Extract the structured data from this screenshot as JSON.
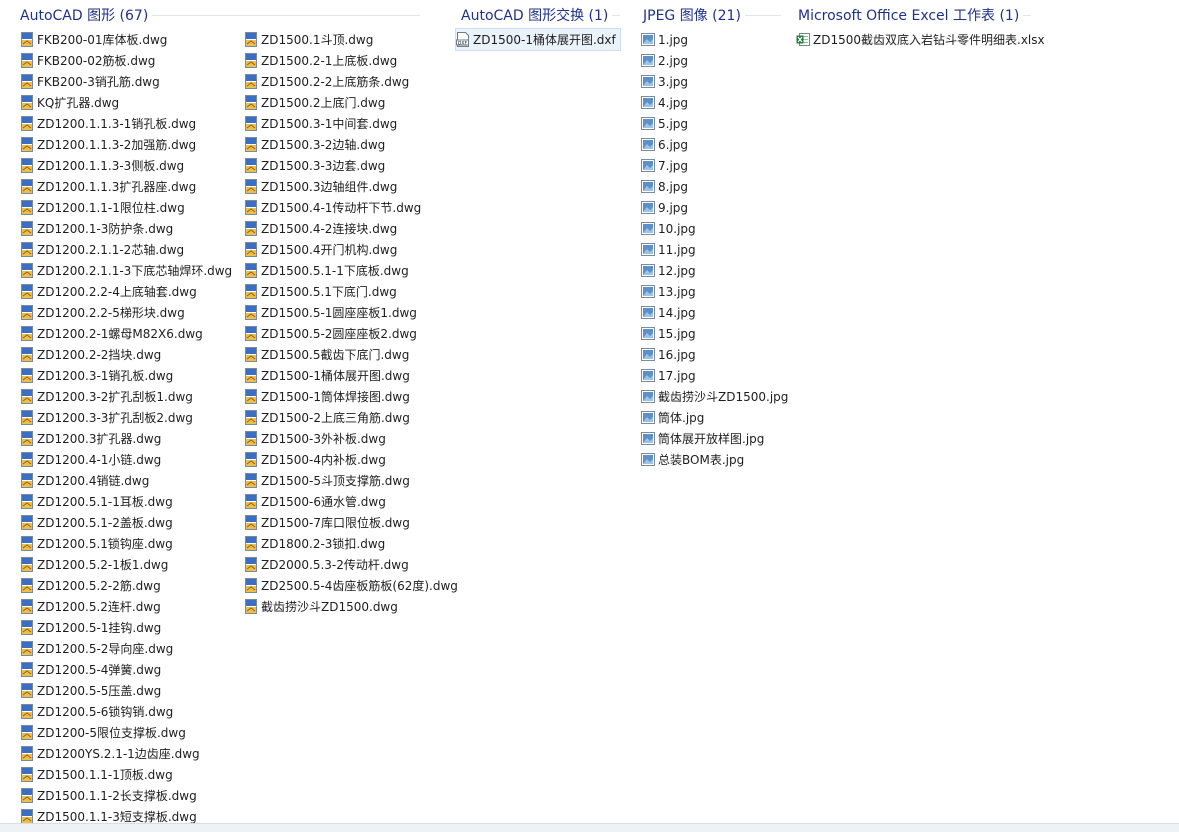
{
  "groups": [
    {
      "key": "dwg",
      "title": "AutoCAD 图形 (67)",
      "icon": "dwg-file-icon",
      "columns": [
        [
          "FKB200-01库体板.dwg",
          "FKB200-02筋板.dwg",
          "FKB200-3销孔筋.dwg",
          "KQ扩孔器.dwg",
          "ZD1200.1.1.3-1销孔板.dwg",
          "ZD1200.1.1.3-2加强筋.dwg",
          "ZD1200.1.1.3-3侧板.dwg",
          "ZD1200.1.1.3扩孔器座.dwg",
          "ZD1200.1.1-1限位柱.dwg",
          "ZD1200.1-3防护条.dwg",
          "ZD1200.2.1.1-2芯轴.dwg",
          "ZD1200.2.1.1-3下底芯轴焊环.dwg",
          "ZD1200.2.2-4上底轴套.dwg",
          "ZD1200.2.2-5梯形块.dwg",
          "ZD1200.2-1螺母M82X6.dwg",
          "ZD1200.2-2挡块.dwg",
          "ZD1200.3-1销孔板.dwg",
          "ZD1200.3-2扩孔刮板1.dwg",
          "ZD1200.3-3扩孔刮板2.dwg",
          "ZD1200.3扩孔器.dwg",
          "ZD1200.4-1小链.dwg",
          "ZD1200.4销链.dwg",
          "ZD1200.5.1-1耳板.dwg",
          "ZD1200.5.1-2盖板.dwg",
          "ZD1200.5.1锁钩座.dwg",
          "ZD1200.5.2-1板1.dwg",
          "ZD1200.5.2-2筋.dwg",
          "ZD1200.5.2连杆.dwg",
          "ZD1200.5-1挂钩.dwg",
          "ZD1200.5-2导向座.dwg",
          "ZD1200.5-4弹簧.dwg",
          "ZD1200.5-5压盖.dwg",
          "ZD1200.5-6锁钩销.dwg",
          "ZD1200-5限位支撑板.dwg",
          "ZD1200YS.2.1-1边齿座.dwg",
          "ZD1500.1.1-1顶板.dwg",
          "ZD1500.1.1-2长支撑板.dwg",
          "ZD1500.1.1-3短支撑板.dwg"
        ],
        [
          "ZD1500.1斗顶.dwg",
          "ZD1500.2-1上底板.dwg",
          "ZD1500.2-2上底筋条.dwg",
          "ZD1500.2上底门.dwg",
          "ZD1500.3-1中间套.dwg",
          "ZD1500.3-2边轴.dwg",
          "ZD1500.3-3边套.dwg",
          "ZD1500.3边轴组件.dwg",
          "ZD1500.4-1传动杆下节.dwg",
          "ZD1500.4-2连接块.dwg",
          "ZD1500.4开门机构.dwg",
          "ZD1500.5.1-1下底板.dwg",
          "ZD1500.5.1下底门.dwg",
          "ZD1500.5-1圆座座板1.dwg",
          "ZD1500.5-2圆座座板2.dwg",
          "ZD1500.5截齿下底门.dwg",
          "ZD1500-1桶体展开图.dwg",
          "ZD1500-1筒体焊接图.dwg",
          "ZD1500-2上底三角筋.dwg",
          "ZD1500-3外补板.dwg",
          "ZD1500-4内补板.dwg",
          "ZD1500-5斗顶支撑筋.dwg",
          "ZD1500-6通水管.dwg",
          "ZD1500-7库口限位板.dwg",
          "ZD1800.2-3锁扣.dwg",
          "ZD2000.5.3-2传动杆.dwg",
          "ZD2500.5-4齿座板筋板(62度).dwg",
          "截齿捞沙斗ZD1500.dwg"
        ]
      ]
    },
    {
      "key": "dxf",
      "title": "AutoCAD 图形交换 (1)",
      "icon": "dxf-file-icon",
      "selected": "ZD1500-1桶体展开图.dxf",
      "columns": [
        [
          "ZD1500-1桶体展开图.dxf"
        ]
      ]
    },
    {
      "key": "jpg",
      "title": "JPEG 图像 (21)",
      "icon": "jpeg-file-icon",
      "columns": [
        [
          "1.jpg",
          "2.jpg",
          "3.jpg",
          "4.jpg",
          "5.jpg",
          "6.jpg",
          "7.jpg",
          "8.jpg",
          "9.jpg",
          "10.jpg",
          "11.jpg",
          "12.jpg",
          "13.jpg",
          "14.jpg",
          "15.jpg",
          "16.jpg",
          "17.jpg",
          "截齿捞沙斗ZD1500.jpg",
          "筒体.jpg",
          "筒体展开放样图.jpg",
          "总装BOM表.jpg"
        ]
      ]
    },
    {
      "key": "xlsx",
      "title": "Microsoft Office Excel 工作表 (1)",
      "icon": "excel-file-icon",
      "columns": [
        [
          "ZD1500截齿双底入岩钻斗零件明细表.xlsx"
        ]
      ]
    }
  ]
}
